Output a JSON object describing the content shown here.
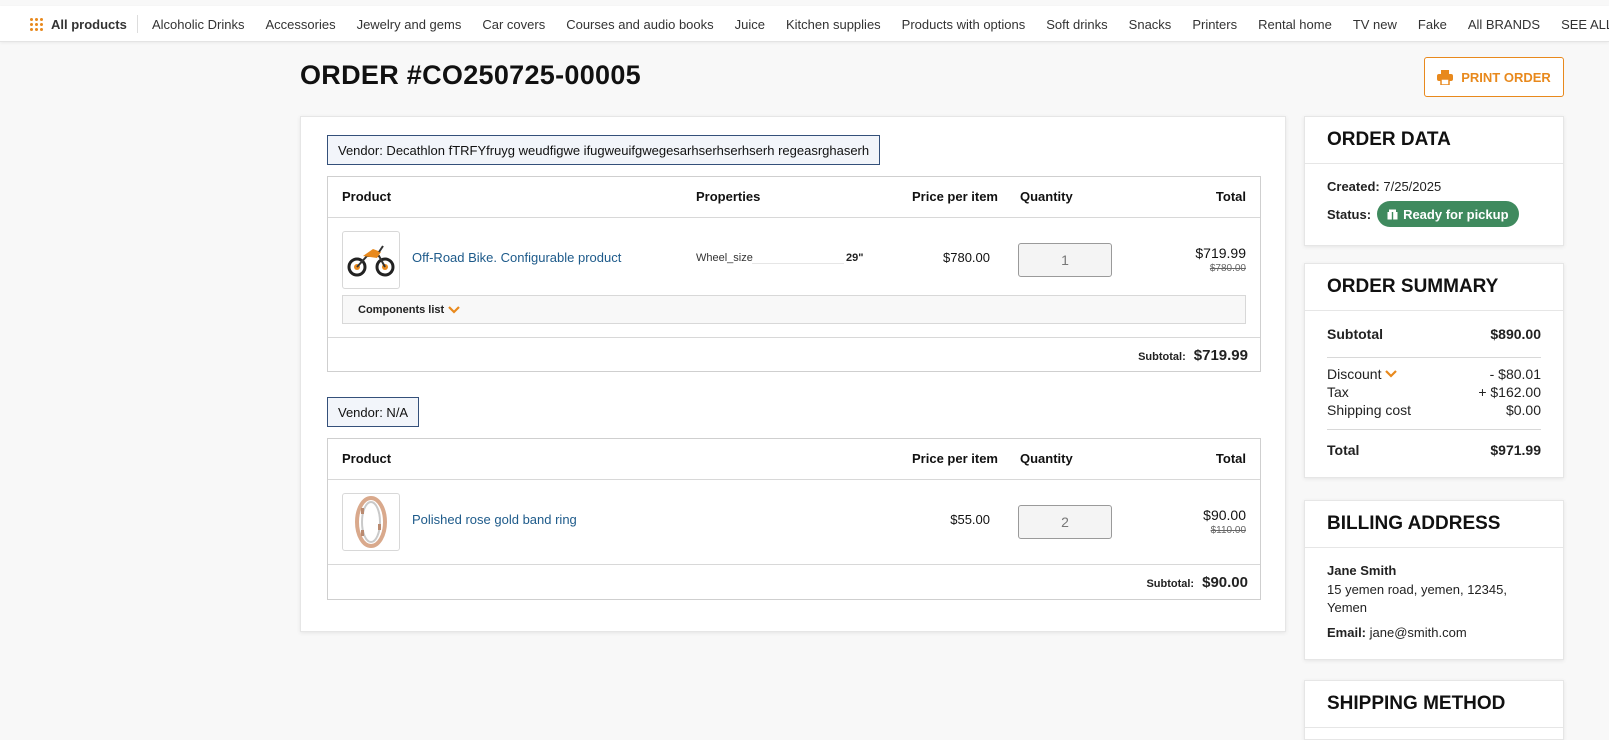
{
  "nav": {
    "all_products": "All products",
    "items": [
      "Alcoholic Drinks",
      "Accessories",
      "Jewelry and gems",
      "Car covers",
      "Courses and audio books",
      "Juice",
      "Kitchen supplies",
      "Products with options",
      "Soft drinks",
      "Snacks",
      "Printers",
      "Rental home",
      "TV new",
      "Fake",
      "All BRANDS",
      "SEE ALL PRODUCTS"
    ]
  },
  "page": {
    "title": "ORDER #CO250725-00005",
    "print_label": "PRINT ORDER"
  },
  "vendors": [
    {
      "label": "Vendor: Decathlon fTRFYfruyg weudfigwe ifugweuifgwegesarhserhserhserh regeasrghaserh",
      "headers": {
        "product": "Product",
        "properties": "Properties",
        "price": "Price per item",
        "quantity": "Quantity",
        "total": "Total"
      },
      "item": {
        "name": "Off-Road Bike. Configurable product",
        "property_name": "Wheel_size",
        "property_value": "29\"",
        "price": "$780.00",
        "quantity": "1",
        "total": "$719.99",
        "old_total": "$780.00"
      },
      "components_label": "Components list",
      "subtotal_label": "Subtotal:",
      "subtotal": "$719.99"
    },
    {
      "label": "Vendor: N/A",
      "headers": {
        "product": "Product",
        "price": "Price per item",
        "quantity": "Quantity",
        "total": "Total"
      },
      "item": {
        "name": "Polished rose gold band ring",
        "price": "$55.00",
        "quantity": "2",
        "total": "$90.00",
        "old_total": "$110.00"
      },
      "subtotal_label": "Subtotal:",
      "subtotal": "$90.00"
    }
  ],
  "order_data": {
    "heading": "ORDER DATA",
    "created_label": "Created:",
    "created": "7/25/2025",
    "status_label": "Status:",
    "status": "Ready for pickup",
    "status_color": "#3f8a5e"
  },
  "summary": {
    "heading": "ORDER SUMMARY",
    "subtotal_label": "Subtotal",
    "subtotal": "$890.00",
    "discount_label": "Discount",
    "discount": "- $80.01",
    "tax_label": "Tax",
    "tax": "+ $162.00",
    "shipping_label": "Shipping cost",
    "shipping": "$0.00",
    "total_label": "Total",
    "total": "$971.99"
  },
  "billing": {
    "heading": "BILLING ADDRESS",
    "name": "Jane Smith",
    "address": "15 yemen road, yemen, 12345, Yemen",
    "email_label": "Email:",
    "email": "jane@smith.com"
  },
  "shipping": {
    "heading": "SHIPPING METHOD"
  },
  "colors": {
    "accent": "#e8891d",
    "link": "#1d5a8a",
    "vendor_border": "#34507a"
  }
}
